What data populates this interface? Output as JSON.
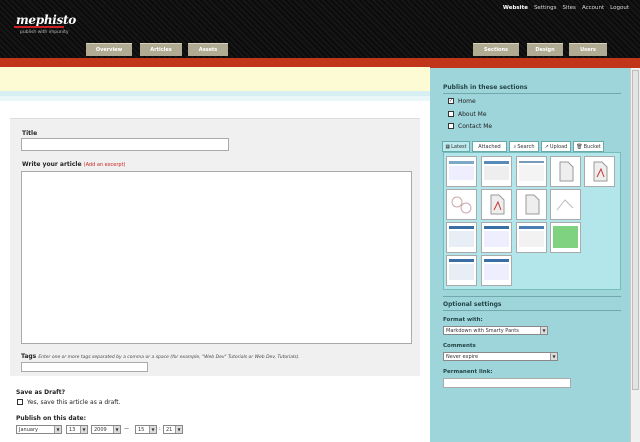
{
  "header": {
    "logo": "mephisto",
    "tagline": "publish with impunity",
    "top_links": [
      "Website",
      "Settings",
      "Sites",
      "Account",
      "Logout"
    ],
    "tabs_left": [
      "Overview",
      "Articles",
      "Assets"
    ],
    "tabs_right": [
      "Sections",
      "Design",
      "Users"
    ]
  },
  "form": {
    "title_label": "Title",
    "title_value": "",
    "body_label": "Write your article",
    "excerpt_link": "(Add an excerpt)",
    "body_value": "",
    "tags_label": "Tags",
    "tags_hint": "Enter one or more tags separated by a comma or a space (for example, \"Web Dev\" Tutorials or Web Dev, Tutorials).",
    "tags_value": "",
    "draft_label": "Save as Draft?",
    "draft_option": "Yes, save this article as a draft.",
    "publish_label": "Publish on this date:",
    "publish": {
      "month": "January",
      "day": "13",
      "year": "2009",
      "sep": "—",
      "hour": "15",
      "colon": ":",
      "minute": "21"
    }
  },
  "sidebar": {
    "sections_title": "Publish in these sections",
    "sections": [
      {
        "label": "Home",
        "checked": true
      },
      {
        "label": "About Me",
        "checked": false
      },
      {
        "label": "Contact Me",
        "checked": false
      }
    ],
    "asset_tabs": [
      "Latest",
      "Attached",
      "Search",
      "Upload",
      "Bucket"
    ],
    "optional_title": "Optional settings",
    "format_label": "Format with:",
    "format_value": "Markdown with Smarty Pants",
    "comments_label": "Comments",
    "comments_value": "Never expire",
    "permalink_label": "Permanent link:",
    "permalink_value": ""
  },
  "colors": {
    "accent_red": "#c1361b",
    "sidebar_bg": "#9ed5db",
    "tab_bg": "#b2ab93"
  }
}
